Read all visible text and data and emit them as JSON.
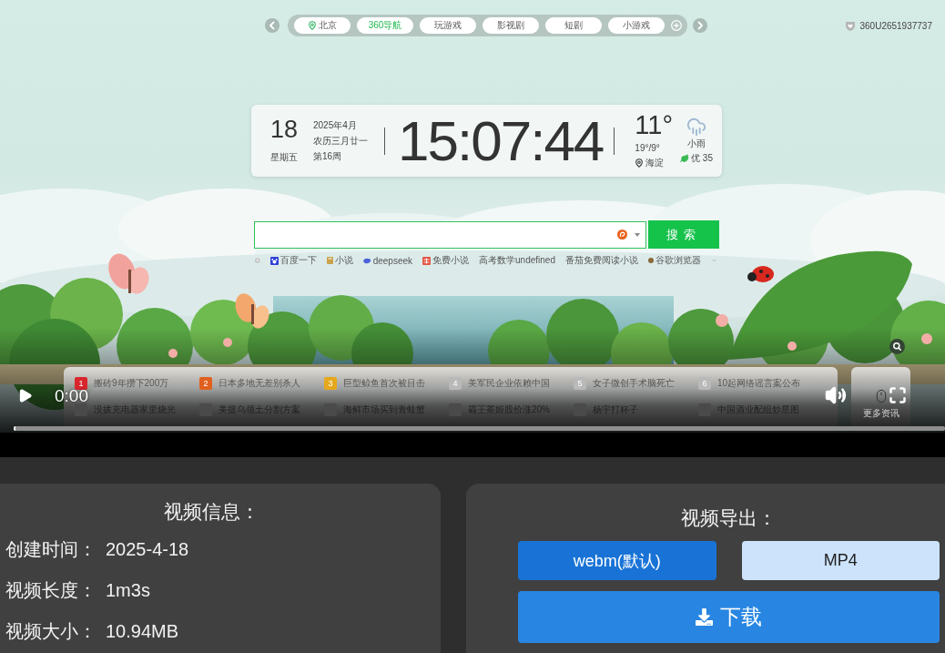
{
  "video": {
    "frame": {
      "nav": {
        "tabs": [
          {
            "label": "北京",
            "kind": "location",
            "selected": false
          },
          {
            "label": "360导航",
            "kind": "plain",
            "selected": true
          },
          {
            "label": "玩游戏",
            "kind": "plain",
            "selected": false
          },
          {
            "label": "影视剧",
            "kind": "plain",
            "selected": false
          },
          {
            "label": "短剧",
            "kind": "plain",
            "selected": false
          },
          {
            "label": "小游戏",
            "kind": "plain",
            "selected": false
          }
        ],
        "user": "360U2651937737"
      },
      "clock": {
        "day": "18",
        "weekday": "星期五",
        "month": "2025年4月",
        "lunar": "农历三月廿一",
        "week": "第16周",
        "time": "15:07:44",
        "temperature": "11°",
        "range": "19°/9°",
        "location": "海淀",
        "weather": "小雨",
        "air_quality": "优 35"
      },
      "search": {
        "button": "搜索",
        "links": [
          {
            "label": "百度一下",
            "kind": "paw"
          },
          {
            "label": "小说",
            "kind": "book"
          },
          {
            "label": "deepseek",
            "kind": "whale"
          },
          {
            "label": "免费小说",
            "kind": "grid"
          },
          {
            "label": "高考数学undefined",
            "kind": "plain"
          },
          {
            "label": "番茄免费阅读小说",
            "kind": "plain"
          },
          {
            "label": "谷歌浏览器",
            "kind": "dot"
          }
        ]
      },
      "news": {
        "items": [
          {
            "rank": "1",
            "title": "搬砖9年攒下200万",
            "color": "#d8262c"
          },
          {
            "rank": "2",
            "title": "日本多地无差别杀人",
            "color": "#e0601f"
          },
          {
            "rank": "3",
            "title": "巨型鲸鱼首次被目击",
            "color": "#e6a81c"
          },
          {
            "rank": "4",
            "title": "美军民企业依赖中国",
            "color": "#b9b9b9"
          },
          {
            "rank": "5",
            "title": "女子微创手术脑死亡",
            "color": "#b9b9b9"
          },
          {
            "rank": "6",
            "title": "10起网络谣言案公布",
            "color": "#b9b9b9"
          },
          {
            "title": "没拔充电器家里烧光",
            "color": "#4a4a4a"
          },
          {
            "title": "美提乌领土分割方案",
            "color": "#4a4a4a"
          },
          {
            "title": "海鲜市场买到青蛙蟹",
            "color": "#4a4a4a"
          },
          {
            "title": "霸王茶姬股价涨20%",
            "color": "#4a4a4a"
          },
          {
            "title": "杨宇打杯子",
            "color": "#4a4a4a"
          },
          {
            "title": "中国酒业配组炒星图",
            "color": "#4a4a4a"
          }
        ],
        "more": "更多资讯"
      }
    },
    "controls": {
      "playing": false,
      "time": "0:00",
      "muted": false,
      "progress": {
        "level": 0
      }
    }
  },
  "info": {
    "title": "视频信息：",
    "rows": [
      {
        "label": "创建时间：",
        "value": "2025-4-18"
      },
      {
        "label": "视频长度：",
        "value": "1m3s"
      },
      {
        "label": "视频大小：",
        "value": "10.94MB"
      }
    ]
  },
  "export": {
    "title": "视频导出：",
    "formats": [
      {
        "label": "webm(默认)",
        "selected": true
      },
      {
        "label": "MP4",
        "selected": false
      }
    ],
    "download": "下载"
  }
}
